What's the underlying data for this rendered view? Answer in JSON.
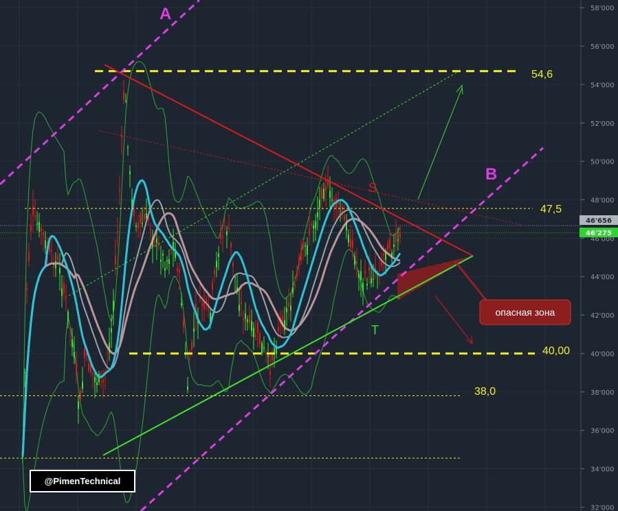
{
  "chart_data": {
    "type": "candlestick",
    "y_axis": {
      "position": "right",
      "range": [
        31800,
        58400
      ],
      "ticks": [
        "32'000",
        "34'000",
        "36'000",
        "38'000",
        "40'000",
        "42'000",
        "44'000",
        "46'000",
        "48'000",
        "50'000",
        "52'000",
        "54'000",
        "56'000",
        "58'000"
      ],
      "grid": true
    },
    "price_tags": [
      {
        "label": "46'656",
        "value": 46656,
        "color": "#b0b6bc"
      },
      {
        "label": "46'275",
        "value": 46275,
        "color": "#2fd42f"
      }
    ],
    "levels": [
      {
        "label": "54,6",
        "value": 54700,
        "style": "dashed-yellow-thick"
      },
      {
        "label": "47,5",
        "value": 47550,
        "style": "dotted-yellow"
      },
      {
        "label": "40,00",
        "value": 40000,
        "style": "dashed-yellow-thick"
      },
      {
        "label": "38,0",
        "value": 37800,
        "style": "dotted-yellow"
      },
      {
        "label": "",
        "value": 34550,
        "style": "dotted-yellow"
      }
    ],
    "annotations": {
      "channel_a_label": "A",
      "channel_b_label": "B",
      "resistance_label": "S",
      "support_label": "T",
      "danger_zone_label": "опасная зона"
    },
    "colors": {
      "background": "#1c2530",
      "grid": "#2b3440",
      "bull_candle": "#2ee62e",
      "bear_candle": "#e01818",
      "levels": "#f3f01a",
      "channels": "#e03ce6",
      "resistance": "#e01818",
      "support": "#41e02c",
      "danger_zone": "#9a1f1f"
    }
  },
  "watermark": "@PimenTechnical"
}
